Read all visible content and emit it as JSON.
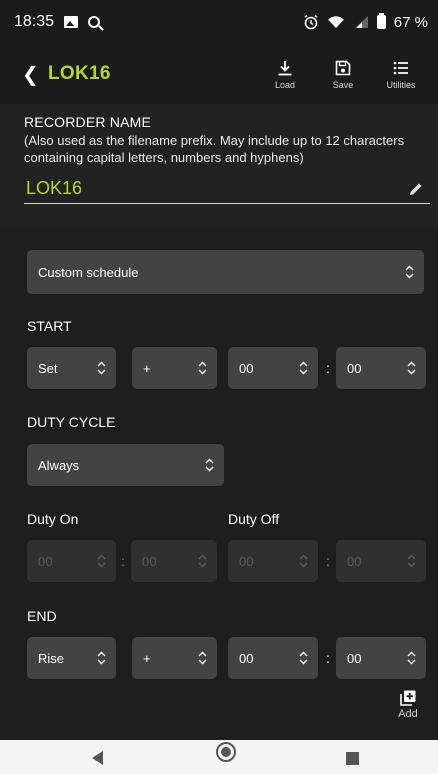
{
  "status": {
    "time": "18:35",
    "battery": "67 %",
    "icons": [
      "image-icon",
      "search-icon",
      "alarm-icon",
      "wifi-icon",
      "signal-icon",
      "battery-icon"
    ]
  },
  "appbar": {
    "title": "LOK16",
    "actions": [
      {
        "label": "Load",
        "icon": "download-icon"
      },
      {
        "label": "Save",
        "icon": "floppy-disk-icon"
      },
      {
        "label": "Utilities",
        "icon": "list-icon"
      }
    ]
  },
  "recorder": {
    "label": "RECORDER NAME",
    "hint": "(Also used as the filename prefix. May include up to 12 characters containing capital letters, numbers and hyphens)",
    "value": "LOK16"
  },
  "schedule": {
    "value": "Custom schedule"
  },
  "start": {
    "label": "START",
    "event": "Set",
    "sign": "+",
    "hours": "00",
    "minutes": "00"
  },
  "duty": {
    "label": "DUTY CYCLE",
    "value": "Always",
    "on_label": "Duty On",
    "off_label": "Duty Off",
    "on_h": "00",
    "on_m": "00",
    "off_h": "00",
    "off_m": "00"
  },
  "end": {
    "label": "END",
    "event": "Rise",
    "sign": "+",
    "hours": "00",
    "minutes": "00"
  },
  "add": {
    "label": "Add"
  },
  "colors": {
    "accent": "#b4d630",
    "field": "#434343",
    "field_disabled": "#303030",
    "background": "#1e1e1e"
  }
}
